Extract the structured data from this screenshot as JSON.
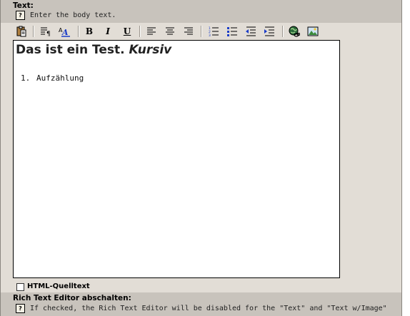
{
  "text_section": {
    "label": "Text:",
    "help_icon": "?",
    "help_text": "Enter the body text."
  },
  "toolbar": {
    "buttons": [
      {
        "name": "paste-icon",
        "label": ""
      },
      {
        "name": "paragraph-format-icon",
        "label": ""
      },
      {
        "name": "font-style-icon",
        "label": ""
      },
      {
        "name": "bold-button",
        "label": "B"
      },
      {
        "name": "italic-button",
        "label": "I"
      },
      {
        "name": "underline-button",
        "label": "U"
      },
      {
        "name": "align-left-icon",
        "label": ""
      },
      {
        "name": "align-center-icon",
        "label": ""
      },
      {
        "name": "align-right-icon",
        "label": ""
      },
      {
        "name": "ordered-list-icon",
        "label": ""
      },
      {
        "name": "unordered-list-icon",
        "label": ""
      },
      {
        "name": "outdent-icon",
        "label": ""
      },
      {
        "name": "indent-icon",
        "label": ""
      },
      {
        "name": "insert-link-icon",
        "label": ""
      },
      {
        "name": "insert-image-icon",
        "label": ""
      }
    ]
  },
  "editor": {
    "heading_normal": "Das ist ein Test.",
    "heading_italic": "Kursiv",
    "list_number": "1.",
    "list_item": "Aufzählung"
  },
  "html_source": {
    "label": "HTML-Quelltext",
    "checked": false
  },
  "rte_section": {
    "label": "Rich Text Editor abschalten:",
    "help_icon": "?",
    "help_text": "If checked, the Rich Text Editor will be disabled for the \"Text\" and \"Text w/Image\""
  }
}
